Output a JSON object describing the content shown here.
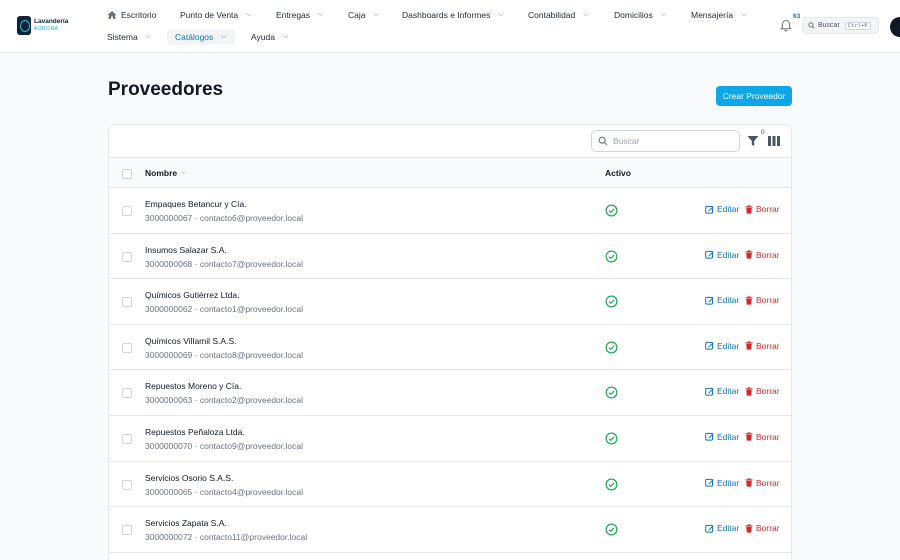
{
  "brand": {
    "name": "Lavandería",
    "sub": "AURORA"
  },
  "nav": {
    "home": "Escritorio",
    "items": [
      {
        "label": "Punto de Venta"
      },
      {
        "label": "Entregas"
      },
      {
        "label": "Caja"
      },
      {
        "label": "Dashboards e Informes"
      },
      {
        "label": "Contabilidad"
      },
      {
        "label": "Domicilios"
      },
      {
        "label": "Mensajería"
      },
      {
        "label": "Sistema"
      },
      {
        "label": "Catálogos"
      },
      {
        "label": "Ayuda"
      }
    ]
  },
  "header": {
    "notifications_count": "63",
    "search_label": "Buscar",
    "search_shortcut": "Ctrl+K"
  },
  "page": {
    "title": "Proveedores",
    "create_label": "Crear Proveedor"
  },
  "table": {
    "search_placeholder": "Buscar",
    "filter_count": "0",
    "columns": {
      "name": "Nombre",
      "active": "Activo"
    },
    "edit_label": "Editar",
    "delete_label": "Borrar",
    "rows": [
      {
        "name": "Empaques Betancur y Cía.",
        "phone": "3000000067",
        "email": "contacto6@proveedor.local",
        "active": true
      },
      {
        "name": "Insumos Salazar S.A.",
        "phone": "3000000068",
        "email": "contacto7@proveedor.local",
        "active": true
      },
      {
        "name": "Químicos Gutiérrez Ltda.",
        "phone": "3000000062",
        "email": "contacto1@proveedor.local",
        "active": true
      },
      {
        "name": "Químicos Villamil S.A.S.",
        "phone": "3000000069",
        "email": "contacto8@proveedor.local",
        "active": true
      },
      {
        "name": "Repuestos Moreno y Cía.",
        "phone": "3000000063",
        "email": "contacto2@proveedor.local",
        "active": true
      },
      {
        "name": "Repuestos Peñaloza Ltda.",
        "phone": "3000000070",
        "email": "contacto9@proveedor.local",
        "active": true
      },
      {
        "name": "Servicios Osorio S.A.S.",
        "phone": "3000000065",
        "email": "contacto4@proveedor.local",
        "active": true
      },
      {
        "name": "Servicios Zapata S.A.",
        "phone": "3000000072",
        "email": "contacto11@proveedor.local",
        "active": true
      }
    ]
  },
  "colors": {
    "accent": "#0ea5e9",
    "link": "#0e74b8",
    "danger": "#dc2626",
    "success": "#16a34a"
  }
}
